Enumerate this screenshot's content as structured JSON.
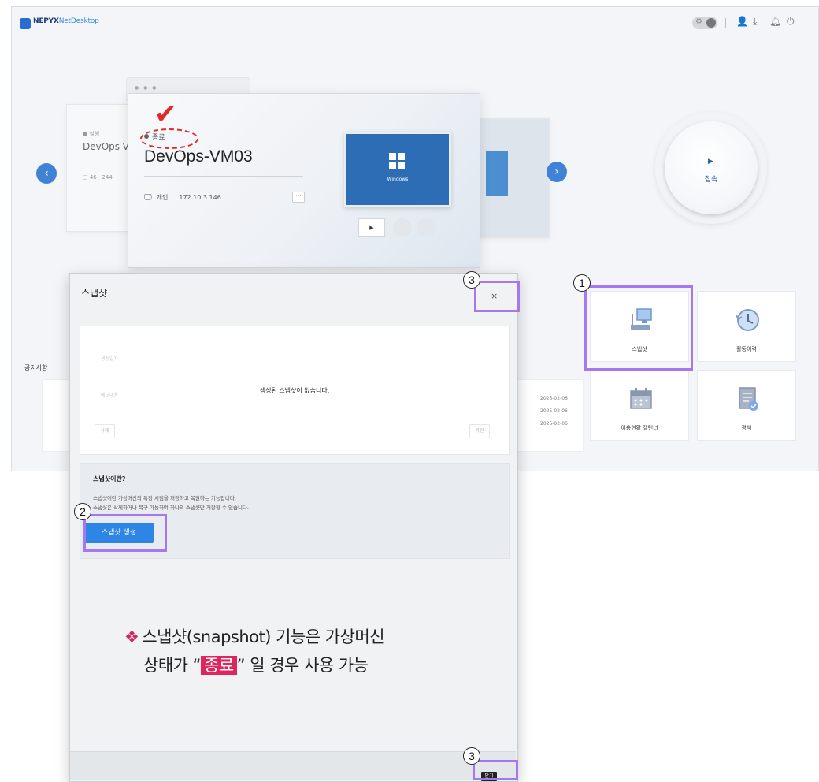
{
  "app": {
    "logo_brand": "NEPYX",
    "logo_product": "NetDesktop"
  },
  "carousel": {
    "left_card": {
      "status": "● 실행",
      "name": "DevOps-V",
      "ip": "▢ 46 · 244"
    },
    "main_card": {
      "status_label": "종료",
      "vm_name": "DevOps-VM03",
      "ip_prefix": "개인",
      "ip": "172.10.3.146",
      "more_label": "···",
      "os_label": "Windows",
      "play_label": "▶"
    }
  },
  "connect": {
    "play_symbol": "▶",
    "label": "접속"
  },
  "notices": {
    "title": "공지사항",
    "dates": [
      "2025-02-06",
      "2025-02-06",
      "2025-02-06"
    ]
  },
  "tiles": [
    {
      "label": "스냅샷"
    },
    {
      "label": "활동이력"
    },
    {
      "label": "이용현황 캘린더"
    },
    {
      "label": "정책"
    }
  ],
  "modal": {
    "title": "스냅샷",
    "close_symbol": "×",
    "list": {
      "col1": "생성일자",
      "col2": "메모내용",
      "empty_message": "생성된 스냅샷이 없습니다.",
      "delete_label": "삭제",
      "restore_label": "복원"
    },
    "info": {
      "heading": "스냅샷이란?",
      "line1": "스냅샷이란 가상머신의 특정 시점을 저장하고 복원하는 기능입니다.",
      "line2": "스냅샷은 삭제하거나 복구 가능하며 하나의 스냅샷만 저장할 수 있습니다."
    },
    "create_button": "스냅샷 생성",
    "footer_close": "닫기"
  },
  "note": {
    "diamond": "❖",
    "line1": "스냅샷(snapshot) 기능은 가상머신",
    "line2_pre": "상태가 “",
    "highlight": "종료",
    "line2_post": "” 일 경우 사용 가능"
  },
  "callouts": {
    "one": "1",
    "two": "2",
    "three": "3"
  },
  "colors": {
    "accent": "#2d86e6",
    "highlight_box": "#a678f0",
    "warning_red": "#e02a2a",
    "note_pink": "#e0245e"
  }
}
